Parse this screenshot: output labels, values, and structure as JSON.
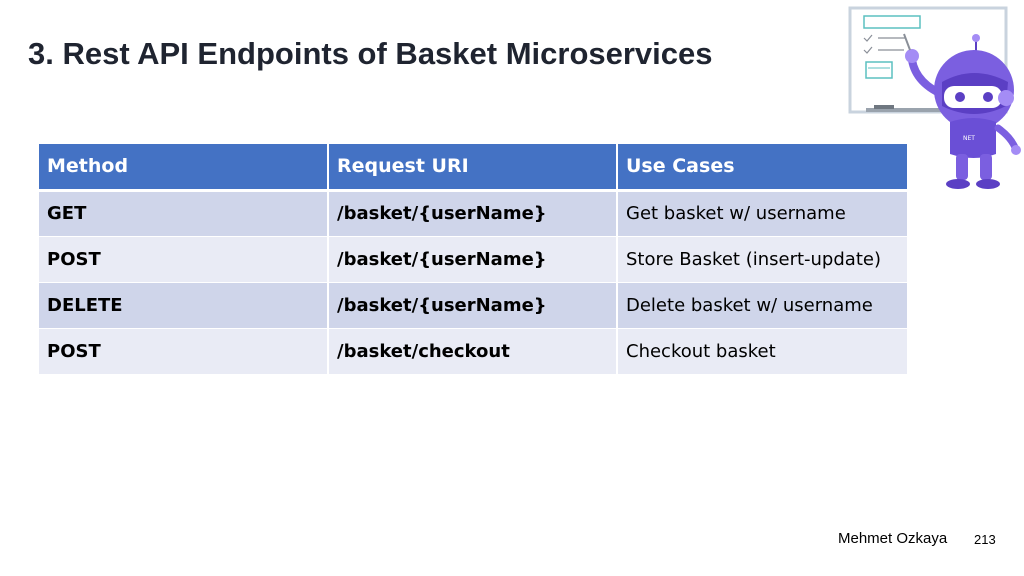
{
  "slide": {
    "title": "3. Rest API Endpoints of Basket Microservices"
  },
  "table": {
    "headers": [
      "Method",
      "Request URI",
      "Use Cases"
    ],
    "rows": [
      {
        "method": "GET",
        "uri": "/basket/{userName}",
        "use_case": "Get basket w/ username"
      },
      {
        "method": "POST",
        "uri": "/basket/{userName}",
        "use_case": "Store Basket (insert-update)"
      },
      {
        "method": "DELETE",
        "uri": "/basket/{userName}",
        "use_case": "Delete basket w/ username"
      },
      {
        "method": "POST",
        "uri": "/basket/checkout",
        "use_case": "Checkout basket"
      }
    ]
  },
  "footer": {
    "author": "Mehmet Ozkaya",
    "page_number": "213"
  },
  "illustration": {
    "icon": "robot-mascot-whiteboard-icon",
    "badge_text": "NET",
    "colors": {
      "robot_body": "#7b5fe0",
      "robot_dark": "#5b3fc4",
      "robot_light": "#a48cf5",
      "board_frame": "#c9d3de",
      "board_lines": "#5cc0c0"
    }
  },
  "colors": {
    "header_bg": "#4472c4",
    "row_odd": "#cfd5ea",
    "row_even": "#e9ebf5",
    "title": "#1f2430"
  }
}
